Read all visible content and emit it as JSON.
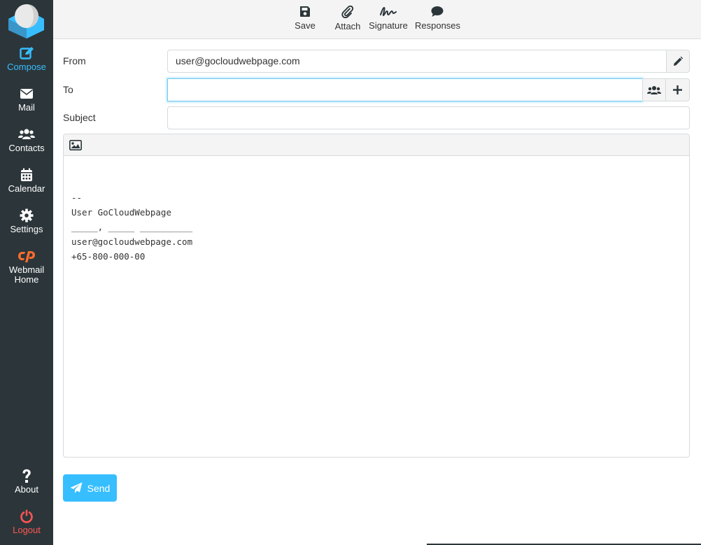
{
  "sidebar": {
    "items": [
      {
        "label": "Compose",
        "icon": "compose-icon",
        "active": true
      },
      {
        "label": "Mail",
        "icon": "envelope-icon"
      },
      {
        "label": "Contacts",
        "icon": "users-icon"
      },
      {
        "label": "Calendar",
        "icon": "calendar-icon"
      },
      {
        "label": "Settings",
        "icon": "gear-icon"
      },
      {
        "label": "Webmail Home",
        "label_line1": "Webmail",
        "label_line2": "Home",
        "icon": "cpanel-icon"
      }
    ],
    "about": {
      "label": "About",
      "icon": "question-icon"
    },
    "logout": {
      "label": "Logout",
      "icon": "power-icon"
    }
  },
  "toolbar": {
    "save_label": "Save",
    "attach_label": "Attach",
    "signature_label": "Signature",
    "responses_label": "Responses"
  },
  "form": {
    "from_label": "From",
    "from_value": "user@gocloudwebpage.com",
    "to_label": "To",
    "to_value": "",
    "subject_label": "Subject",
    "subject_value": ""
  },
  "editor": {
    "lines": [
      "--",
      "User GoCloudWebpage",
      "_____, _____ __________",
      "user@gocloudwebpage.com",
      "+65-800-000-00"
    ]
  },
  "send_label": "Send",
  "colors": {
    "sidebar_bg": "#2c363a",
    "accent": "#37beff",
    "logout": "#ff5552",
    "cpanel": "#ff6c2c"
  }
}
